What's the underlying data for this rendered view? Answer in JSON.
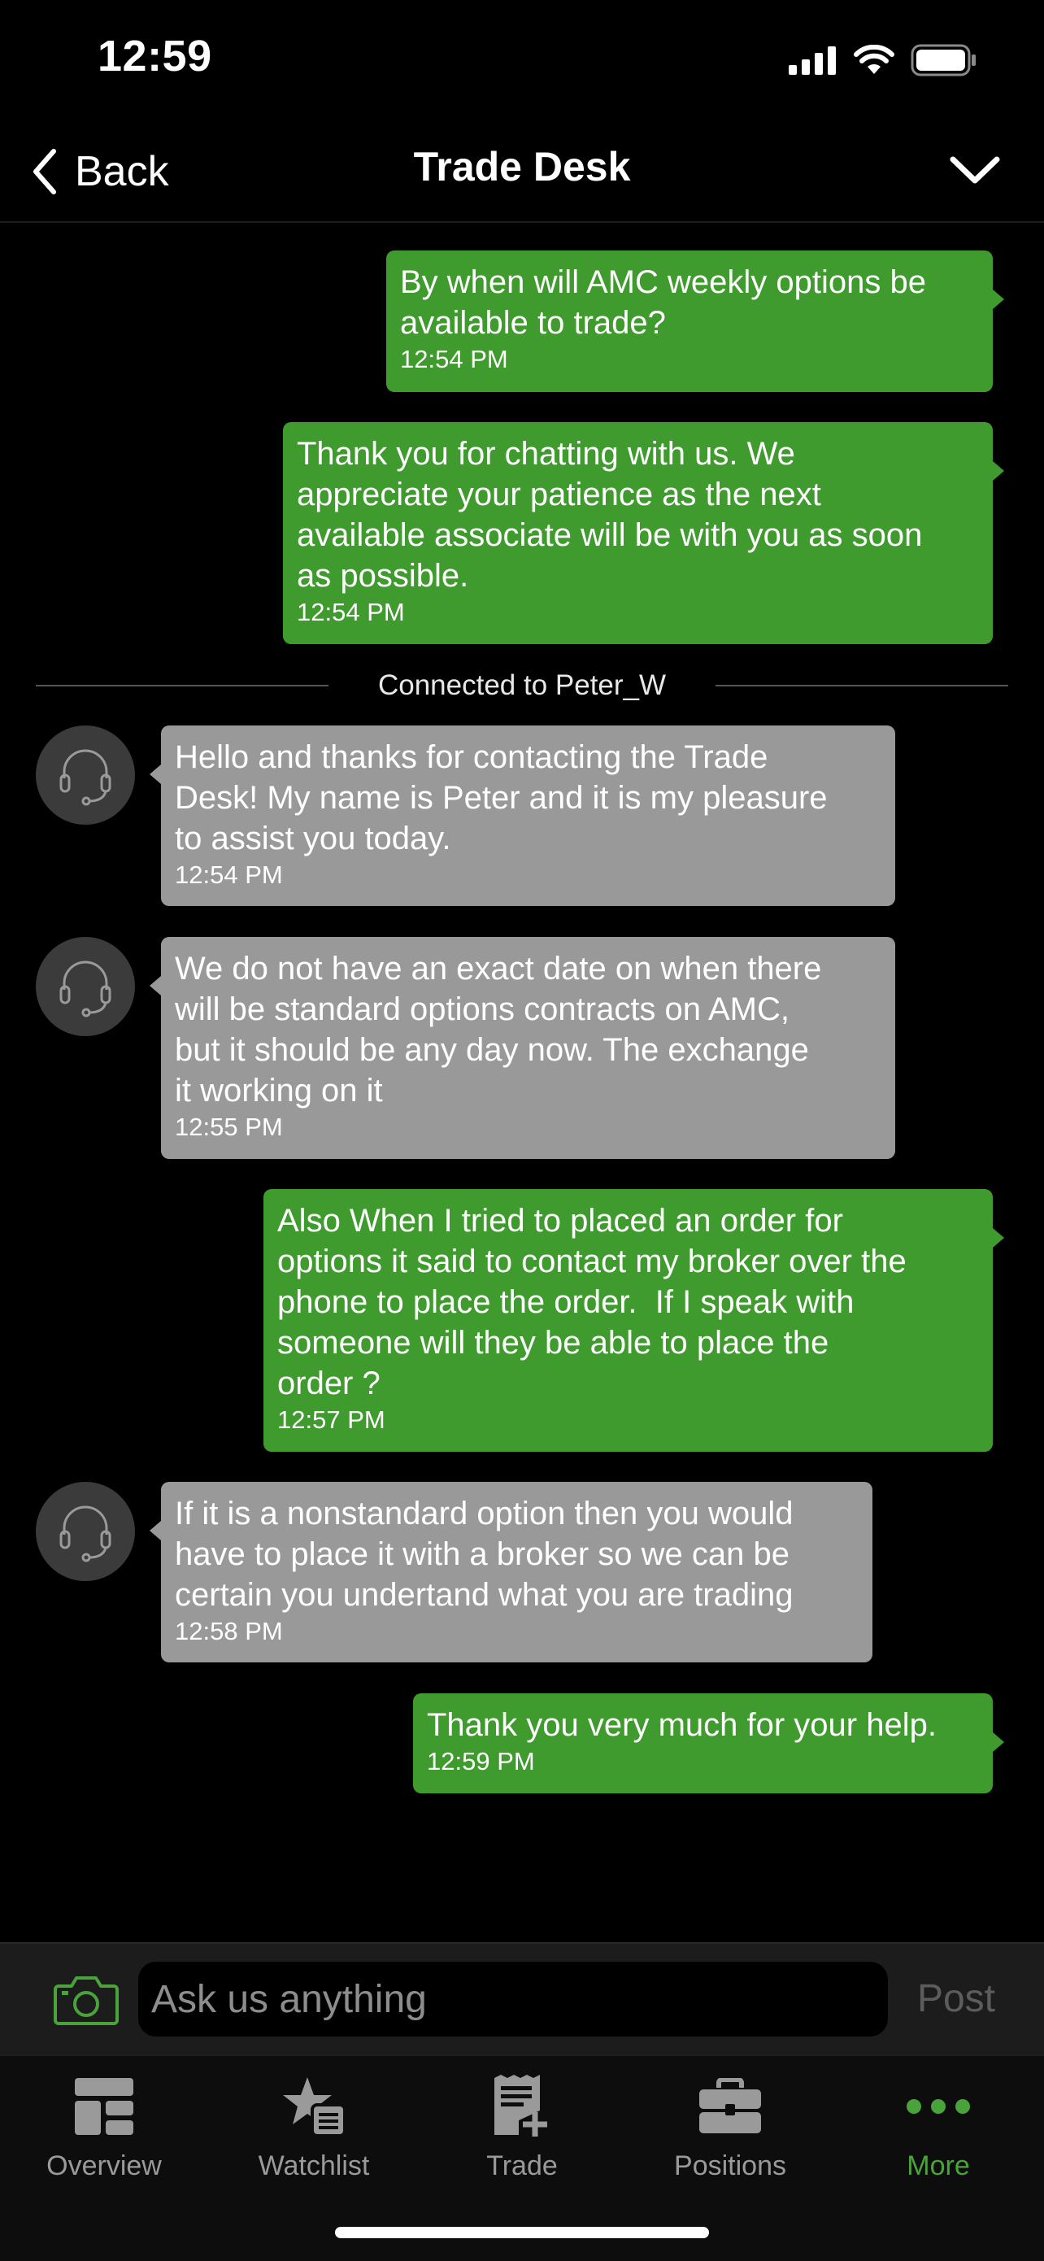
{
  "status_bar": {
    "time": "12:59"
  },
  "nav": {
    "back_label": "Back",
    "title": "Trade Desk"
  },
  "divider": {
    "label": "Connected to Peter_W"
  },
  "messages": [
    {
      "sender": "user",
      "text": "By when will AMC weekly options be\navailable to trade?",
      "time": "12:54 PM"
    },
    {
      "sender": "system",
      "text": "Thank you for chatting with us. We\nappreciate your patience as the next\navailable associate will be with you as soon\nas possible.",
      "time": "12:54 PM"
    },
    {
      "sender": "agent",
      "text": "Hello and thanks for contacting the Trade\nDesk! My name is Peter and it is my pleasure\nto assist you today.",
      "time": "12:54 PM"
    },
    {
      "sender": "agent",
      "text": "We do not have an exact date on when there\nwill be standard options contracts on AMC,\nbut it should be any day now. The exchange\nit working on it",
      "time": "12:55 PM"
    },
    {
      "sender": "user",
      "text": "Also When I tried to placed an order for\noptions it said to contact my broker over the\nphone to place the order.  If I speak with\nsomeone will they be able to place the\norder ?",
      "time": "12:57 PM"
    },
    {
      "sender": "agent",
      "text": "If it is a nonstandard option then you would\nhave to place it with a broker so we can be\ncertain you undertand what you are trading",
      "time": "12:58 PM"
    },
    {
      "sender": "user",
      "text": "Thank you very much for your help.",
      "time": "12:59 PM"
    }
  ],
  "input": {
    "placeholder": "Ask us anything",
    "post_label": "Post"
  },
  "tabs": [
    {
      "label": "Overview",
      "icon": "overview-grid-icon"
    },
    {
      "label": "Watchlist",
      "icon": "watchlist-star-icon"
    },
    {
      "label": "Trade",
      "icon": "trade-ticket-icon"
    },
    {
      "label": "Positions",
      "icon": "briefcase-icon"
    },
    {
      "label": "More",
      "icon": "more-dots-icon",
      "active": true
    }
  ],
  "colors": {
    "sent_bubble": "#3f9b2e",
    "received_bubble": "#999999",
    "accent": "#49a33a"
  }
}
